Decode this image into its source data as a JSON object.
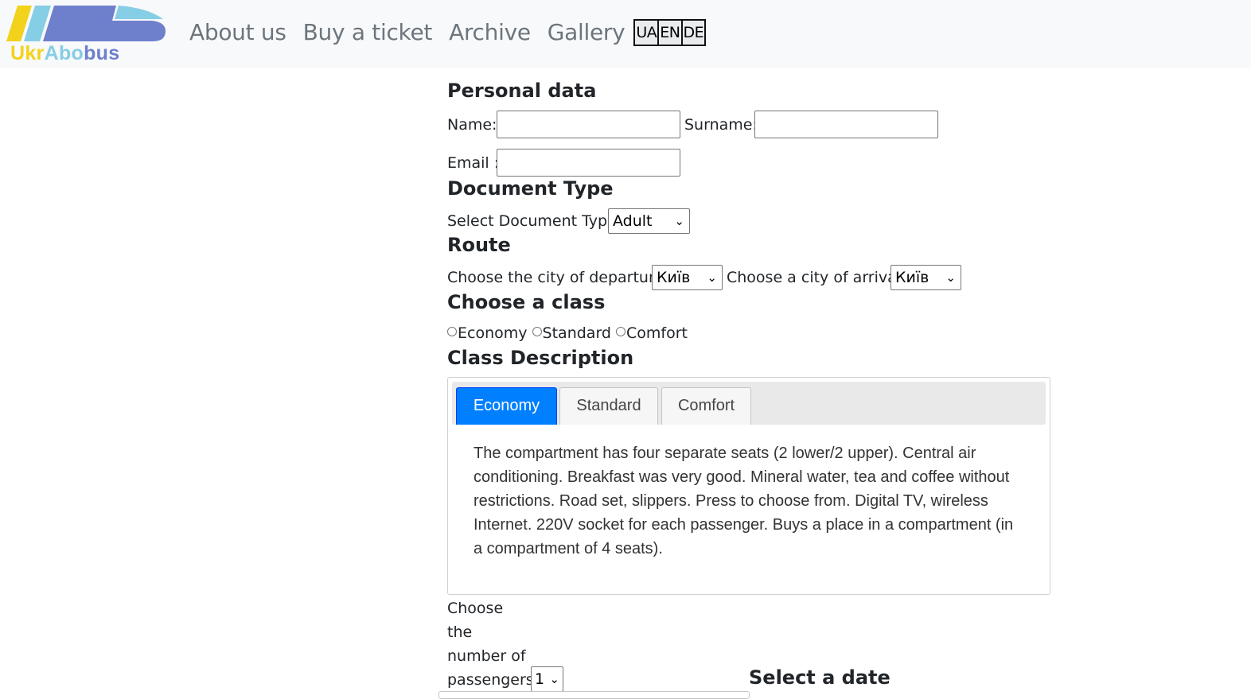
{
  "brand": {
    "part1": "Ukr",
    "part2": "Abo",
    "part3": "bus"
  },
  "nav": {
    "links": [
      "About us",
      "Buy a ticket",
      "Archive",
      "Gallery"
    ],
    "languages": [
      "UA",
      "EN",
      "DE"
    ]
  },
  "personal": {
    "heading": "Personal data",
    "name_label": "Name:",
    "name_value": "",
    "surname_label": "Surname:",
    "surname_value": "",
    "email_label": "Email :",
    "email_value": ""
  },
  "document": {
    "heading": "Document Type",
    "label": "Select Document Type",
    "selected": "Adult"
  },
  "route": {
    "heading": "Route",
    "departure_label": "Choose the city of departure",
    "departure_selected": "Київ",
    "arrival_label": "Choose a city of arrival",
    "arrival_selected": "Київ"
  },
  "class_choice": {
    "heading": "Choose a class",
    "options": [
      "Economy",
      "Standard",
      "Comfort"
    ]
  },
  "class_description": {
    "heading": "Class Description",
    "tabs": [
      "Economy",
      "Standard",
      "Comfort"
    ],
    "active_tab": "Economy",
    "content": "The compartment has four separate seats (2 lower/2 upper). Central air conditioning. Breakfast was very good. Mineral water, tea and coffee without restrictions. Road set, slippers. Press to choose from. Digital TV, wireless Internet. 220V socket for each passenger. Buys a place in a compartment (in a compartment of 4 seats)."
  },
  "passengers": {
    "label_lines": [
      "Choose",
      "the",
      "number of",
      "passengers"
    ],
    "selected": "1"
  },
  "date": {
    "heading": "Select a date"
  },
  "colors": {
    "navbar_bg": "#f8f9fa",
    "nav_link": "#6c757d",
    "active_tab": "#007fff",
    "logo_yellow": "#f2d21b",
    "logo_lightblue": "#86cde6",
    "logo_blue": "#6e7fcc"
  }
}
